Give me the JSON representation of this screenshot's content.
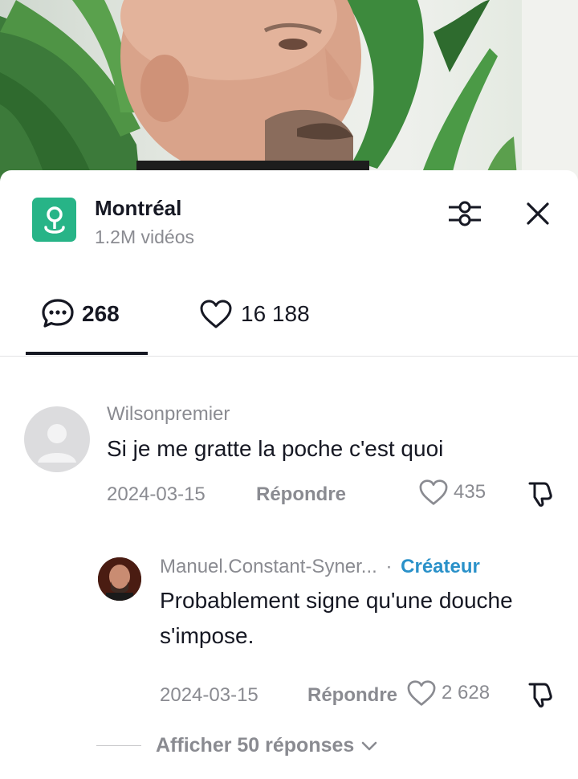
{
  "place": {
    "name": "Montréal",
    "video_count": "1.2M vidéos",
    "icon": "location-pin-icon",
    "icon_color": "#27b487"
  },
  "tabs": {
    "comments_count": "268",
    "likes_count": "16 188"
  },
  "comments": [
    {
      "username": "Wilsonpremier",
      "text": "Si je me gratte la poche c'est quoi",
      "date": "2024-03-15",
      "reply_label": "Répondre",
      "likes": "435"
    }
  ],
  "reply": {
    "username": "Manuel.Constant-Syner...",
    "separator": "·",
    "creator_label": "Créateur",
    "text": "Probablement signe qu'une douche s'impose.",
    "date": "2024-03-15",
    "reply_label": "Répondre",
    "likes": "2 628"
  },
  "more_replies_label": "Afficher 50 réponses",
  "colors": {
    "accent_creator": "#2a91c9",
    "muted_text": "#8a8b91",
    "primary_text": "#161823"
  }
}
